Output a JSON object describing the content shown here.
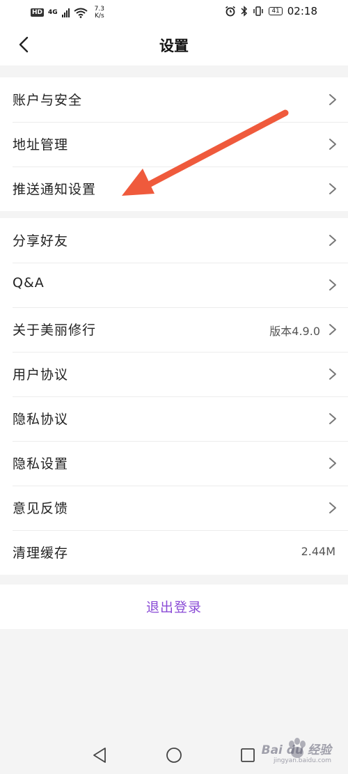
{
  "status_bar": {
    "hd": "HD",
    "network": "4G",
    "speed_value": "7.3",
    "speed_unit": "K/s",
    "battery": "41",
    "time": "02:18"
  },
  "header": {
    "title": "设置"
  },
  "groups": [
    {
      "items": [
        {
          "label": "账户与安全",
          "value": ""
        },
        {
          "label": "地址管理",
          "value": ""
        },
        {
          "label": "推送通知设置",
          "value": ""
        }
      ]
    },
    {
      "items": [
        {
          "label": "分享好友",
          "value": ""
        },
        {
          "label": "Q&A",
          "value": ""
        },
        {
          "label": "关于美丽修行",
          "value": "版本4.9.0"
        },
        {
          "label": "用户协议",
          "value": ""
        },
        {
          "label": "隐私协议",
          "value": ""
        },
        {
          "label": "隐私设置",
          "value": ""
        },
        {
          "label": "意见反馈",
          "value": ""
        },
        {
          "label": "清理缓存",
          "value": "2.44M"
        }
      ]
    }
  ],
  "logout": {
    "label": "退出登录"
  },
  "watermark": {
    "brand": "Bai du 经验",
    "url": "jingyan.baidu.com"
  },
  "colors": {
    "accent": "#8a4bd6",
    "annotation_arrow": "#ef5a3c"
  },
  "icons": {
    "back": "chevron-left-icon",
    "row": "chevron-right-icon"
  }
}
